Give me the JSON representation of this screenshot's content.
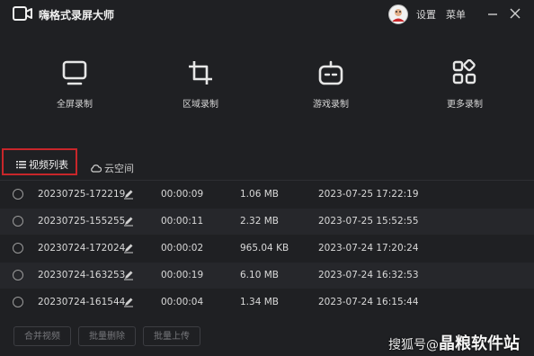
{
  "window": {
    "title": "嗨格式录屏大师",
    "settings_label": "设置",
    "menu_label": "菜单",
    "minimize_icon": "minimize-icon",
    "close_icon": "close-icon"
  },
  "tools": [
    {
      "label": "全屏录制",
      "icon": "monitor-icon"
    },
    {
      "label": "区域录制",
      "icon": "crop-icon"
    },
    {
      "label": "游戏录制",
      "icon": "gamepad-icon"
    },
    {
      "label": "更多录制",
      "icon": "grid-icon"
    }
  ],
  "tabs": {
    "video_list": "视频列表",
    "cloud": "云空间"
  },
  "recordings": [
    {
      "name": "20230725-172219",
      "duration": "00:00:09",
      "size": "1.06 MB",
      "date": "2023-07-25 17:22:19"
    },
    {
      "name": "20230725-155255",
      "duration": "00:00:11",
      "size": "2.32 MB",
      "date": "2023-07-25 15:52:55"
    },
    {
      "name": "20230724-172024",
      "duration": "00:00:02",
      "size": "965.04 KB",
      "date": "2023-07-24 17:20:24"
    },
    {
      "name": "20230724-163253",
      "duration": "00:00:19",
      "size": "6.10 MB",
      "date": "2023-07-24 16:32:53"
    },
    {
      "name": "20230724-161544",
      "duration": "00:00:04",
      "size": "1.34 MB",
      "date": "2023-07-24 16:15:44"
    }
  ],
  "actions": {
    "merge": "合并视频",
    "batch_delete": "批量删除",
    "batch_upload": "批量上传"
  },
  "watermark": {
    "source": "搜狐号@",
    "brand": "晶粮软件站"
  },
  "colors": {
    "background": "#1f2023",
    "row_alt": "#26272b",
    "highlight": "#c8262a"
  }
}
